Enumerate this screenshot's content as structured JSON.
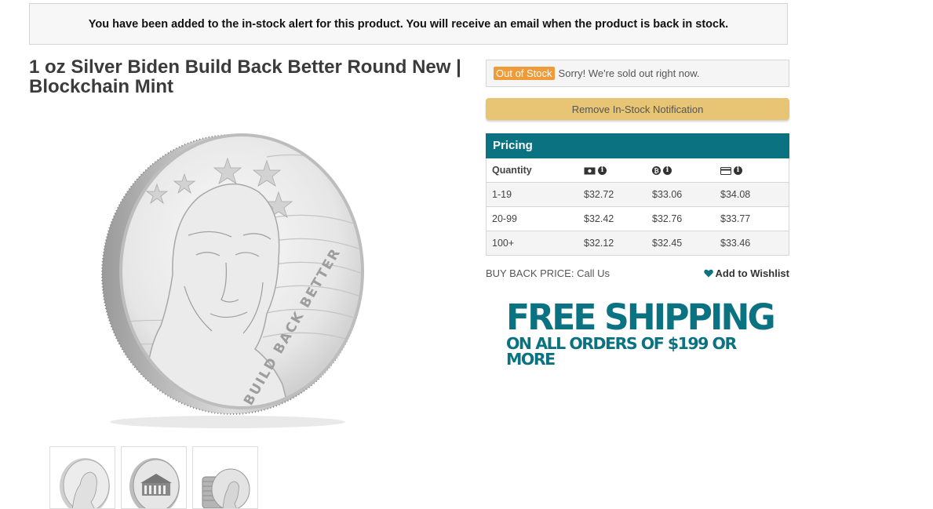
{
  "alert": {
    "message": "You have been added to the in-stock alert for this product. You will receive an email when the product is back in stock."
  },
  "product": {
    "title": "1 oz Silver Biden Build Back Better Round New | Blockchain Mint",
    "coin_inscription": "BUILD BACK BETTER"
  },
  "stock": {
    "badge": "Out of Stock",
    "message": "Sorry! We're sold out right now."
  },
  "remove_button": {
    "label": "Remove In-Stock Notification"
  },
  "pricing": {
    "heading": "Pricing",
    "quantity_label": "Quantity",
    "payment_icons": [
      "cash-icon",
      "crypto-icon",
      "credit-card-icon"
    ],
    "rows": [
      {
        "qty": "1-19",
        "cash": "$32.72",
        "crypto": "$33.06",
        "card": "$34.08"
      },
      {
        "qty": "20-99",
        "cash": "$32.42",
        "crypto": "$32.76",
        "card": "$33.77"
      },
      {
        "qty": "100+",
        "cash": "$32.12",
        "crypto": "$32.45",
        "card": "$33.46"
      }
    ]
  },
  "buyback": {
    "text": "BUY BACK PRICE: Call Us"
  },
  "wishlist": {
    "label": "Add to Wishlist"
  },
  "shipping_banner": {
    "line1": "FREE SHIPPING",
    "line2": "ON ALL ORDERS OF $199 OR MORE"
  },
  "colors": {
    "teal": "#0b7282",
    "gold_button": "#e8c475",
    "badge_orange": "#ef9b3a"
  }
}
